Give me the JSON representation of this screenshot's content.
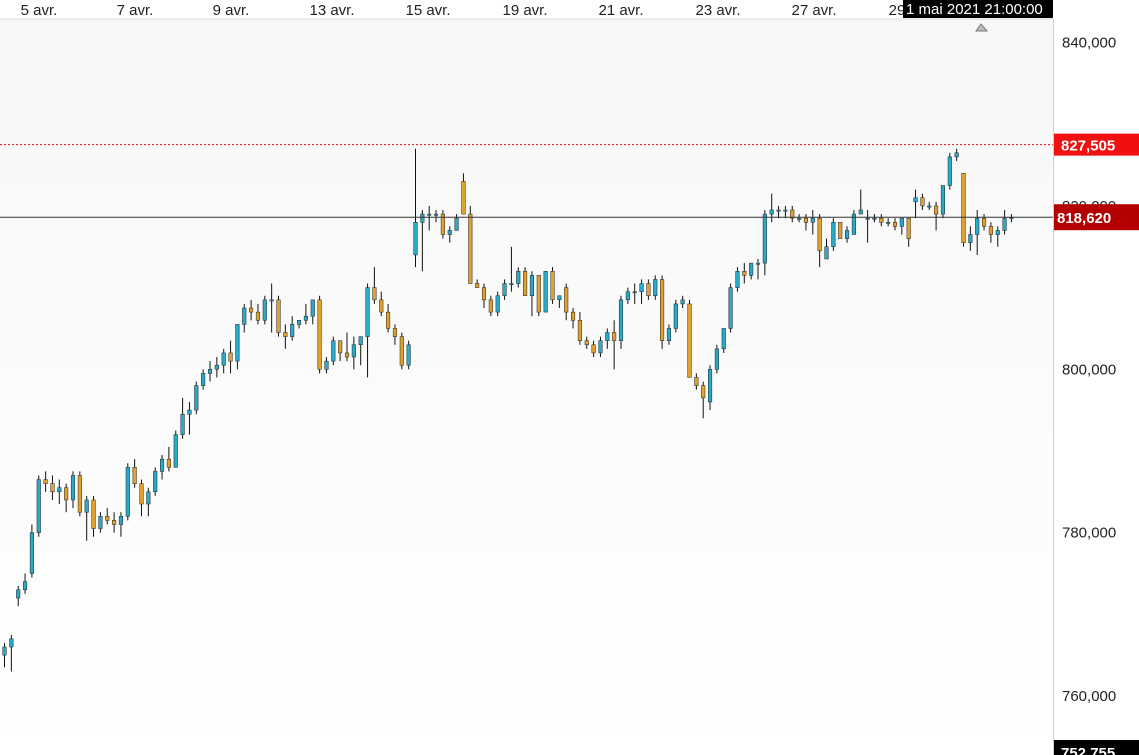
{
  "chart_data": {
    "type": "candlestick",
    "colors": {
      "up": "#2aa9c9",
      "down": "#e0a12e",
      "wick": "#111111",
      "max_line": "#e01010",
      "max_tag": "#f01010",
      "last_tag": "#b40000",
      "last_line": "#333333",
      "axis_line": "#cfcfcf",
      "cursor_bg": "#000000",
      "bottom_tag": "#000000"
    },
    "x_ticks": [
      "5 avr.",
      "7 avr.",
      "9 avr.",
      "13 avr.",
      "15 avr.",
      "19 avr.",
      "21 avr.",
      "23 avr.",
      "27 avr.",
      "29"
    ],
    "y_ticks": [
      "840,000",
      "820,000",
      "800,000",
      "780,000",
      "760,000"
    ],
    "y_range": [
      752.755,
      843
    ],
    "max_value": 827.505,
    "max_label": "827,505",
    "last_value": 818.62,
    "last_label": "818,620",
    "bottom_label": "752,755",
    "cursor_label": "1 mai 2021 21:00:00",
    "candles": [
      [
        765.0,
        766.5,
        763.5,
        766.0
      ],
      [
        766.0,
        767.5,
        763.0,
        767.0
      ],
      [
        772.0,
        773.5,
        771.0,
        773.0
      ],
      [
        773.0,
        775.0,
        772.5,
        774.0
      ],
      [
        775.0,
        781.0,
        774.5,
        780.0
      ],
      [
        780.0,
        787.0,
        779.5,
        786.5
      ],
      [
        786.5,
        787.5,
        785.0,
        786.0
      ],
      [
        786.0,
        787.0,
        784.0,
        785.0
      ],
      [
        785.0,
        786.5,
        783.5,
        785.5
      ],
      [
        785.5,
        786.0,
        782.5,
        784.0
      ],
      [
        784.0,
        787.5,
        783.0,
        787.0
      ],
      [
        787.0,
        787.5,
        782.0,
        782.5
      ],
      [
        782.5,
        784.5,
        779.0,
        784.0
      ],
      [
        784.0,
        784.5,
        779.5,
        780.5
      ],
      [
        780.5,
        782.5,
        780.0,
        782.0
      ],
      [
        782.0,
        783.0,
        781.0,
        781.5
      ],
      [
        781.5,
        782.5,
        780.0,
        781.0
      ],
      [
        781.0,
        782.5,
        779.5,
        782.0
      ],
      [
        782.0,
        788.5,
        781.5,
        788.0
      ],
      [
        788.0,
        789.0,
        785.5,
        786.0
      ],
      [
        786.0,
        786.5,
        782.0,
        783.5
      ],
      [
        783.5,
        785.5,
        782.0,
        785.0
      ],
      [
        785.0,
        788.0,
        784.5,
        787.5
      ],
      [
        787.5,
        789.5,
        786.5,
        789.0
      ],
      [
        789.0,
        790.5,
        787.5,
        788.0
      ],
      [
        788.0,
        792.5,
        788.0,
        792.0
      ],
      [
        792.0,
        796.5,
        791.5,
        794.5
      ],
      [
        794.5,
        796.0,
        792.0,
        795.0
      ],
      [
        795.0,
        798.5,
        794.5,
        798.0
      ],
      [
        798.0,
        800.0,
        797.5,
        799.5
      ],
      [
        799.5,
        801.0,
        798.5,
        800.0
      ],
      [
        800.0,
        801.5,
        799.0,
        800.5
      ],
      [
        800.5,
        802.5,
        799.5,
        802.0
      ],
      [
        802.0,
        803.5,
        799.5,
        801.0
      ],
      [
        801.0,
        805.5,
        800.0,
        805.5
      ],
      [
        805.5,
        808.0,
        804.5,
        807.5
      ],
      [
        807.5,
        808.5,
        806.0,
        807.0
      ],
      [
        807.0,
        808.0,
        805.5,
        806.0
      ],
      [
        806.0,
        809.0,
        805.5,
        808.5
      ],
      [
        808.5,
        810.5,
        804.5,
        808.5
      ],
      [
        808.5,
        809.0,
        804.0,
        804.5
      ],
      [
        804.5,
        805.5,
        802.5,
        804.0
      ],
      [
        804.0,
        806.5,
        803.5,
        805.5
      ],
      [
        805.5,
        806.0,
        805.0,
        806.0
      ],
      [
        806.0,
        808.0,
        805.5,
        806.5
      ],
      [
        806.5,
        808.5,
        805.5,
        808.5
      ],
      [
        808.5,
        809.0,
        799.5,
        800.0
      ],
      [
        800.0,
        801.5,
        799.5,
        801.0
      ],
      [
        801.0,
        804.0,
        800.5,
        803.5
      ],
      [
        803.5,
        803.5,
        801.0,
        802.0
      ],
      [
        802.0,
        804.5,
        801.0,
        801.5
      ],
      [
        801.5,
        804.0,
        800.0,
        803.0
      ],
      [
        803.0,
        804.0,
        800.5,
        804.0
      ],
      [
        804.0,
        810.5,
        799.0,
        810.0
      ],
      [
        810.0,
        812.5,
        808.0,
        808.5
      ],
      [
        808.5,
        809.5,
        806.5,
        807.0
      ],
      [
        807.0,
        808.0,
        804.5,
        805.0
      ],
      [
        805.0,
        805.5,
        803.0,
        804.0
      ],
      [
        804.0,
        804.5,
        800.0,
        800.5
      ],
      [
        800.5,
        803.5,
        800.0,
        803.0
      ],
      [
        814.0,
        827.0,
        812.5,
        818.0
      ],
      [
        818.0,
        819.5,
        812.0,
        819.0
      ],
      [
        819.0,
        820.0,
        817.0,
        819.0
      ],
      [
        819.0,
        819.5,
        818.0,
        819.0
      ],
      [
        819.0,
        819.5,
        816.0,
        816.5
      ],
      [
        816.5,
        817.5,
        815.5,
        817.0
      ],
      [
        817.0,
        819.0,
        817.0,
        818.5
      ],
      [
        823.0,
        824.0,
        819.0,
        819.0
      ],
      [
        819.0,
        820.0,
        810.5,
        810.5
      ],
      [
        810.5,
        811.0,
        810.0,
        810.0
      ],
      [
        810.0,
        810.5,
        807.5,
        808.5
      ],
      [
        808.5,
        809.0,
        806.5,
        807.0
      ],
      [
        807.0,
        809.5,
        806.5,
        809.0
      ],
      [
        809.0,
        811.0,
        808.5,
        810.5
      ],
      [
        810.5,
        815.0,
        809.5,
        810.5
      ],
      [
        810.5,
        812.5,
        810.0,
        812.0
      ],
      [
        812.0,
        812.5,
        809.0,
        809.0
      ],
      [
        809.0,
        812.0,
        806.5,
        811.5
      ],
      [
        811.5,
        811.5,
        806.5,
        807.0
      ],
      [
        807.0,
        812.0,
        807.0,
        812.0
      ],
      [
        812.0,
        812.5,
        808.0,
        808.5
      ],
      [
        808.5,
        809.0,
        807.5,
        809.0
      ],
      [
        810.0,
        810.5,
        806.0,
        807.0
      ],
      [
        807.0,
        807.5,
        805.0,
        806.0
      ],
      [
        806.0,
        807.0,
        803.0,
        803.5
      ],
      [
        803.5,
        804.0,
        802.5,
        803.0
      ],
      [
        803.0,
        803.5,
        801.5,
        802.0
      ],
      [
        802.0,
        804.0,
        801.5,
        803.5
      ],
      [
        803.5,
        805.0,
        802.5,
        804.5
      ],
      [
        804.5,
        806.0,
        800.0,
        803.5
      ],
      [
        803.5,
        809.0,
        802.5,
        808.5
      ],
      [
        808.5,
        810.0,
        808.0,
        809.5
      ],
      [
        809.5,
        810.5,
        808.0,
        809.5
      ],
      [
        809.5,
        811.0,
        808.0,
        810.5
      ],
      [
        810.5,
        811.0,
        808.5,
        809.0
      ],
      [
        809.0,
        811.5,
        808.5,
        811.0
      ],
      [
        811.0,
        811.5,
        802.5,
        803.5
      ],
      [
        803.5,
        805.5,
        803.0,
        805.0
      ],
      [
        805.0,
        808.5,
        804.5,
        808.0
      ],
      [
        808.0,
        809.0,
        807.5,
        808.5
      ],
      [
        808.0,
        808.5,
        799.0,
        799.0
      ],
      [
        799.0,
        799.5,
        797.5,
        798.0
      ],
      [
        798.0,
        798.5,
        794.0,
        796.5
      ],
      [
        796.0,
        800.5,
        795.0,
        800.0
      ],
      [
        800.0,
        803.0,
        799.5,
        802.5
      ],
      [
        802.5,
        805.0,
        802.0,
        805.0
      ],
      [
        805.0,
        810.5,
        804.5,
        810.0
      ],
      [
        810.0,
        812.5,
        809.5,
        812.0
      ],
      [
        812.0,
        813.0,
        810.5,
        811.5
      ],
      [
        811.5,
        813.0,
        811.0,
        813.0
      ],
      [
        813.0,
        813.5,
        811.0,
        813.0
      ],
      [
        813.0,
        819.5,
        811.5,
        819.0
      ],
      [
        819.0,
        821.5,
        818.0,
        819.5
      ],
      [
        819.5,
        820.0,
        818.5,
        819.5
      ],
      [
        819.5,
        820.0,
        818.5,
        819.5
      ],
      [
        819.5,
        820.0,
        818.0,
        818.5
      ],
      [
        818.5,
        819.0,
        818.0,
        818.5
      ],
      [
        818.5,
        819.0,
        817.0,
        818.0
      ],
      [
        818.0,
        819.5,
        816.5,
        818.5
      ],
      [
        818.5,
        819.0,
        812.5,
        814.5
      ],
      [
        813.5,
        816.0,
        813.5,
        815.0
      ],
      [
        815.0,
        818.5,
        814.5,
        818.0
      ],
      [
        818.0,
        818.0,
        816.0,
        816.0
      ],
      [
        816.0,
        817.5,
        815.5,
        817.0
      ],
      [
        816.5,
        819.5,
        816.5,
        819.0
      ],
      [
        819.0,
        822.0,
        819.0,
        819.5
      ],
      [
        818.5,
        819.5,
        815.5,
        818.5
      ],
      [
        818.5,
        819.0,
        818.0,
        818.5
      ],
      [
        818.5,
        819.0,
        817.5,
        818.0
      ],
      [
        818.0,
        818.5,
        817.5,
        818.0
      ],
      [
        818.0,
        818.5,
        817.0,
        817.5
      ],
      [
        817.5,
        818.5,
        816.5,
        818.5
      ],
      [
        818.5,
        818.5,
        815.0,
        816.0
      ],
      [
        820.5,
        822.0,
        818.5,
        821.0
      ],
      [
        821.0,
        821.5,
        819.5,
        820.0
      ],
      [
        820.0,
        820.5,
        819.5,
        820.0
      ],
      [
        820.0,
        820.5,
        817.0,
        819.0
      ],
      [
        819.0,
        822.5,
        818.5,
        822.5
      ],
      [
        822.5,
        826.5,
        822.0,
        826.0
      ],
      [
        826.0,
        827.0,
        825.5,
        826.5
      ],
      [
        824.0,
        824.0,
        815.0,
        815.5
      ],
      [
        815.5,
        817.5,
        814.5,
        816.5
      ],
      [
        816.5,
        819.5,
        814.0,
        818.5
      ],
      [
        818.5,
        819.0,
        817.0,
        817.5
      ],
      [
        817.5,
        818.0,
        815.5,
        816.5
      ],
      [
        816.5,
        817.5,
        815.0,
        817.0
      ],
      [
        817.0,
        819.5,
        816.5,
        818.5
      ],
      [
        818.5,
        819.0,
        818.0,
        818.6
      ]
    ]
  }
}
